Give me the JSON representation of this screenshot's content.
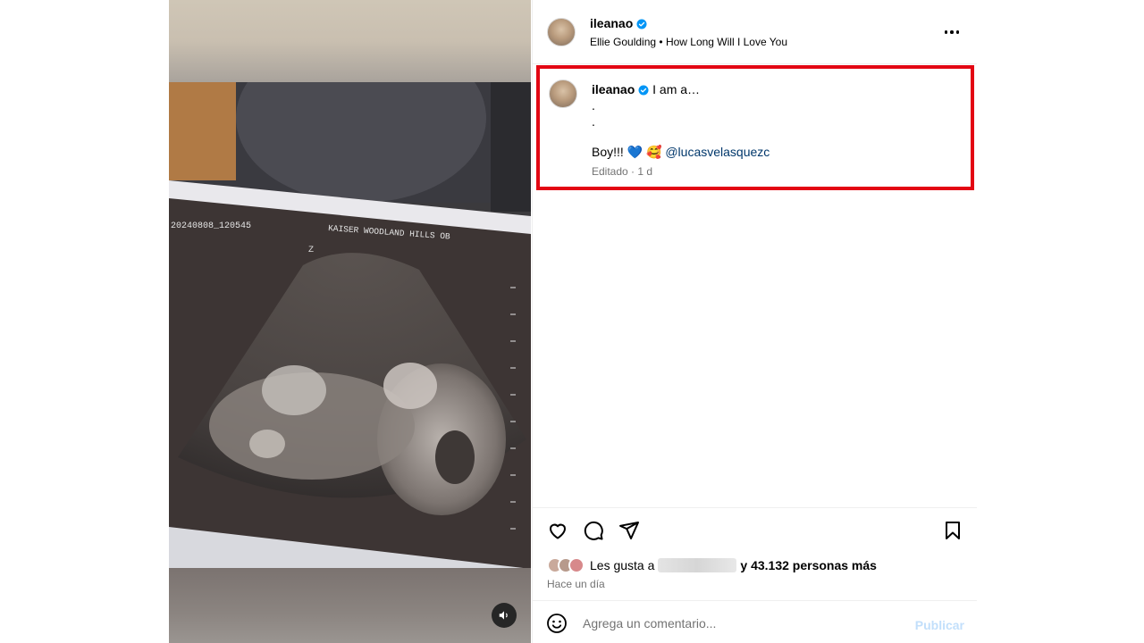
{
  "media": {
    "ultrasound_header": "20240808_120545",
    "ultrasound_clinic": "KAISER WOODLAND HILLS OB",
    "ultrasound_marker": "Z",
    "sound_icon": "volume-icon"
  },
  "header": {
    "username": "ileanao",
    "artist": "Ellie Goulding",
    "separator": "•",
    "song": "How Long Will I Love You",
    "more_icon": "more-horizontal-icon"
  },
  "caption": {
    "username": "ileanao",
    "first_line": "I am a…",
    "dot1": ".",
    "dot2": ".",
    "boy_text": "Boy!!!",
    "emoji_heart": "💙",
    "emoji_face": "🥰",
    "mention": "@lucasvelasquezc",
    "edited": "Editado",
    "dot_sep": "·",
    "age": "1 d",
    "highlight_color": "#e30613"
  },
  "actions": {
    "like_icon": "heart-icon",
    "comment_icon": "comment-icon",
    "share_icon": "send-icon",
    "save_icon": "bookmark-icon",
    "likes_prefix": "Les gusta a",
    "likes_suffix": "y 43.132 personas más",
    "time": "Hace un día"
  },
  "comment": {
    "emoji_icon": "smiley-icon",
    "placeholder": "Agrega un comentario...",
    "publish": "Publicar"
  },
  "colors": {
    "verified": "#0095f6",
    "mention": "#00376b",
    "publish_disabled": "#c2dffb"
  }
}
